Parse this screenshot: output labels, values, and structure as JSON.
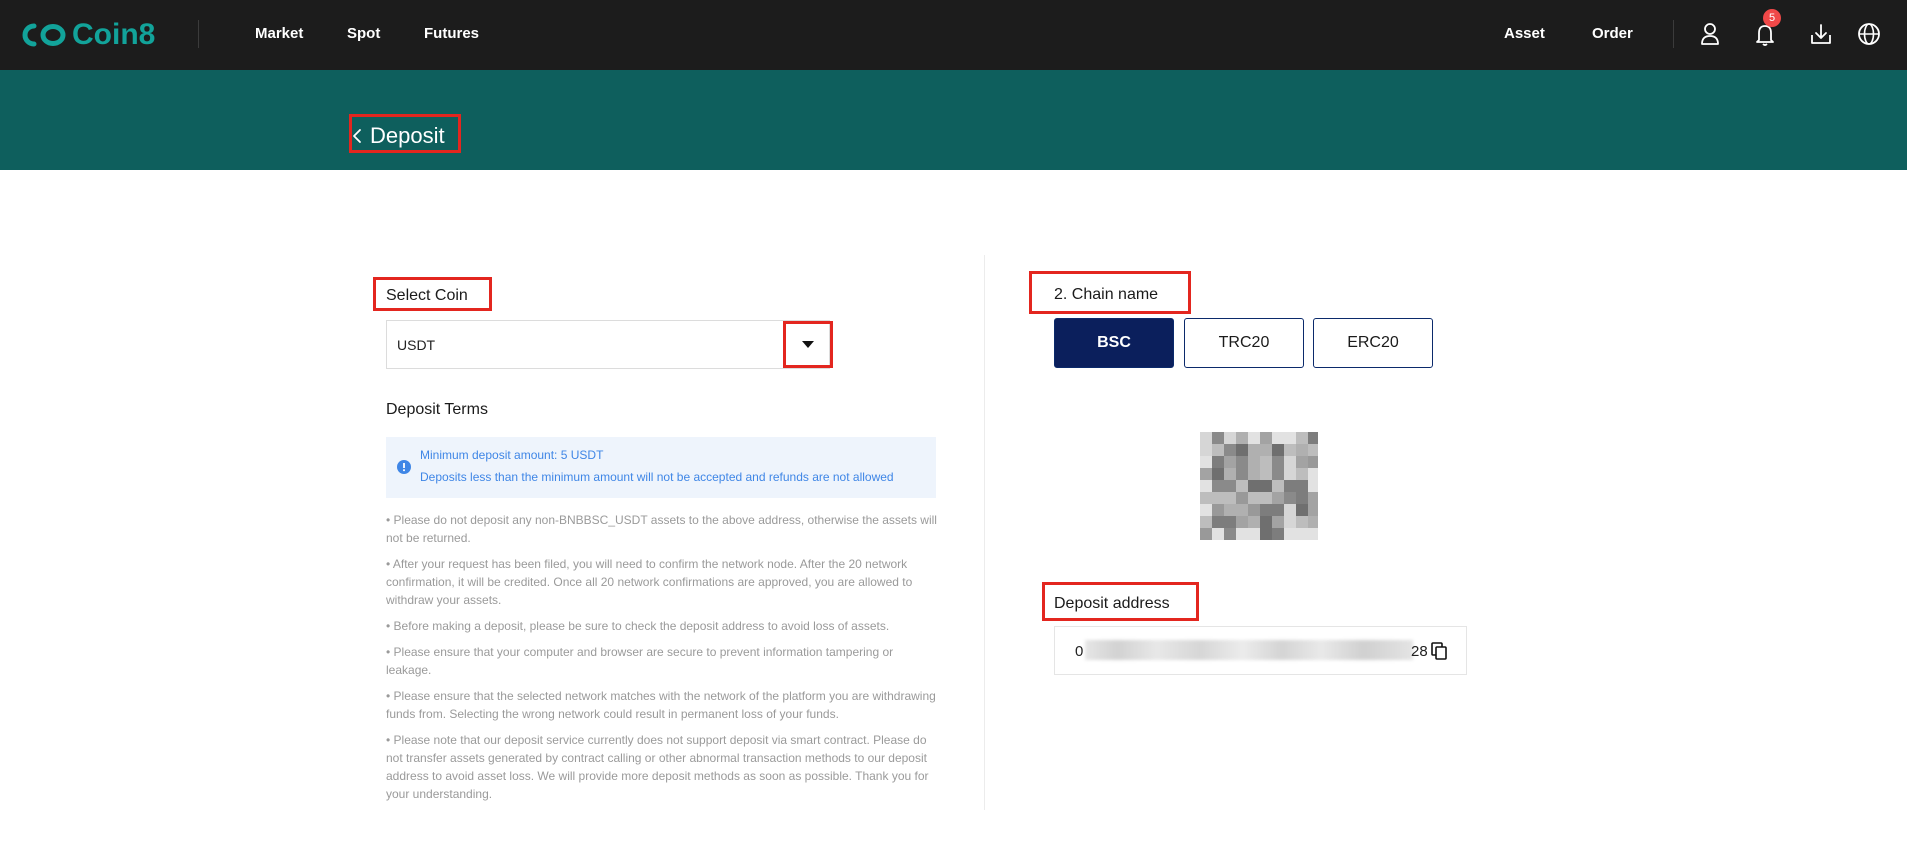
{
  "app": {
    "brand": "Coin8",
    "brand_color": "#12a39a"
  },
  "nav": {
    "links": [
      "Market",
      "Spot",
      "Futures"
    ],
    "right_links": [
      "Asset",
      "Order"
    ],
    "notification_count": "5",
    "icons": [
      "user-icon",
      "bell-icon",
      "download-icon",
      "globe-icon"
    ]
  },
  "header": {
    "title": "Deposit",
    "banner_color": "#0e5f5d"
  },
  "select_coin": {
    "label": "Select Coin",
    "value": "USDT"
  },
  "deposit_terms": {
    "heading": "Deposit Terms",
    "notice": [
      "Minimum deposit amount: 5 USDT",
      "Deposits less than the minimum amount will not be accepted and refunds are not allowed"
    ],
    "items": [
      "• Please do not deposit any non-BNBBSC_USDT assets to the above address, otherwise the assets will not be returned.",
      "• After your request has been filed, you will need to confirm the network node. After the 20 network confirmation, it will be credited. Once all 20 network confirmations are approved, you are allowed to withdraw your assets.",
      "• Before making a deposit, please be sure to check the deposit address to avoid loss of assets.",
      "• Please ensure that your computer and browser are secure to prevent information tampering or leakage.",
      "• Please ensure that the selected network matches with the network of the platform you are withdrawing funds from. Selecting the wrong network could result in permanent loss of your funds.",
      "• Please note that our deposit service currently does not support deposit via smart contract. Please do not transfer assets generated by contract calling or other abnormal transaction methods to our deposit address to avoid asset loss. We will provide more deposit methods as soon as possible. Thank you for your understanding."
    ]
  },
  "chain": {
    "label": "2. Chain name",
    "options": [
      "BSC",
      "TRC20",
      "ERC20"
    ],
    "selected": "BSC",
    "active_color": "#0b1f5c"
  },
  "deposit_address": {
    "label": "Deposit address",
    "prefix": "0",
    "suffix": "28"
  },
  "highlight_color": "#e3261f"
}
